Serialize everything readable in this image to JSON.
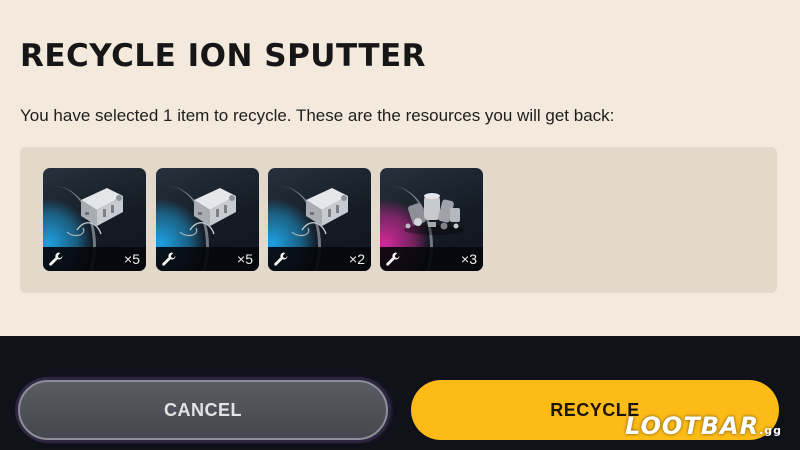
{
  "dialog": {
    "title": "RECYCLE ION SPUTTER",
    "message": "You have selected 1 item to recycle. These are the resources you will get back:"
  },
  "resources": [
    {
      "icon": "mechanical-components-icon",
      "quantity": "×5",
      "rarity_color": "#1fa0e0"
    },
    {
      "icon": "mechanical-components-icon",
      "quantity": "×5",
      "rarity_color": "#1fa0e0"
    },
    {
      "icon": "mechanical-components-icon",
      "quantity": "×2",
      "rarity_color": "#1fa0e0"
    },
    {
      "icon": "scrap-parts-pile-icon",
      "quantity": "×3",
      "rarity_color": "#d02a9a"
    }
  ],
  "actions": {
    "cancel_label": "CANCEL",
    "recycle_label": "RECYCLE"
  },
  "watermark": {
    "brand": "LOOTBAR",
    "suffix": ".gg"
  },
  "colors": {
    "dialog_background": "#f3e9dc",
    "panel_background": "#e3d9cb",
    "bottom_bar": "#0f1218",
    "recycle_button": "#fdbb18",
    "cancel_button": "#55575e"
  }
}
